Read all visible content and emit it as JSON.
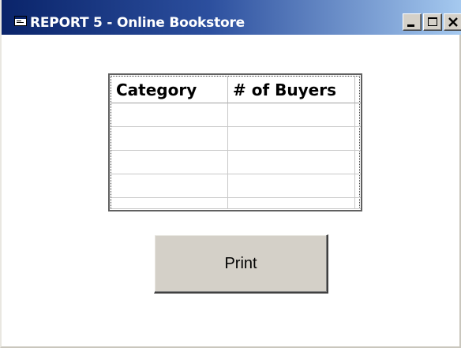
{
  "window": {
    "title": "REPORT 5 - Online Bookstore",
    "icons": {
      "app": "form-window-icon",
      "minimize": "minimize-icon",
      "maximize": "maximize-icon",
      "close": "close-icon"
    },
    "colors": {
      "titlebar_start": "#0a246a",
      "titlebar_end": "#a6caf0",
      "button_face": "#d4d0c8"
    }
  },
  "grid": {
    "columns": [
      "Category",
      "# of Buyers"
    ],
    "rows": [
      [
        "",
        ""
      ],
      [
        "",
        ""
      ],
      [
        "",
        ""
      ],
      [
        "",
        ""
      ],
      [
        "",
        ""
      ]
    ]
  },
  "actions": {
    "print_label": "Print"
  }
}
